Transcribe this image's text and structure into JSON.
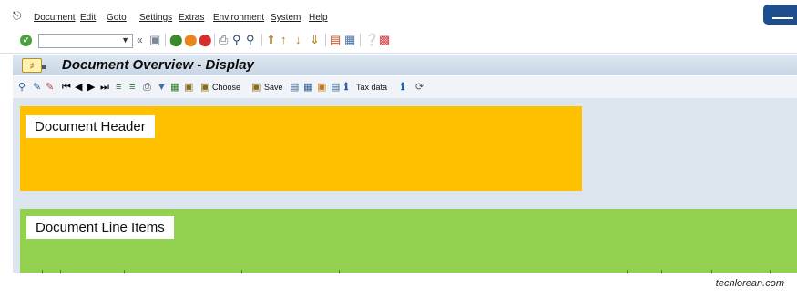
{
  "menubar": {
    "items": [
      "Document",
      "Edit",
      "Goto",
      "Settings",
      "Extras",
      "Environment",
      "System",
      "Help"
    ]
  },
  "standard_toolbar": {
    "back_glyph": "«",
    "icons": [
      "ok-icon",
      "save-icon",
      "back-icon",
      "exit-icon",
      "cancel-icon",
      "print-icon",
      "find-icon",
      "find-next-icon",
      "first-page-icon",
      "previous-page-icon",
      "next-page-icon",
      "last-page-icon",
      "create-session-icon",
      "shortcut-icon",
      "help-icon",
      "customize-layout-icon"
    ]
  },
  "title": {
    "text": "Document Overview - Display"
  },
  "app_toolbar": {
    "choose_label": "Choose",
    "save_label": "Save",
    "tax_label": "Tax data"
  },
  "sections": {
    "header": "Document Header",
    "line_items": "Document Line Items"
  },
  "colors": {
    "header_block": "#ffc000",
    "line_items_block": "#92d050",
    "title_bar": "#c7d5e4",
    "ok_button": "#47a23f"
  },
  "footer": {
    "credit": "techlorean.com"
  }
}
